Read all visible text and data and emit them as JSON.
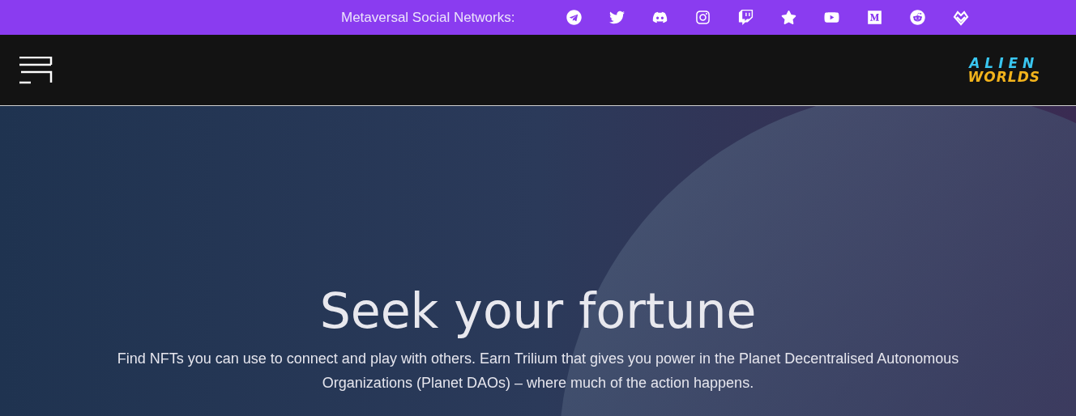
{
  "social_bar": {
    "label": "Metaversal Social Networks:"
  },
  "header": {
    "logo": {
      "line_1": "ALIEN",
      "line_2": "WORLDS"
    }
  },
  "hero": {
    "title": "Seek your fortune",
    "text": "Find NFTs you can use to connect and play with others. Earn Trilium that gives you power in the Planet Decentralised Autonomous Organizations (Planet DAOs) – where much of the action happens."
  }
}
